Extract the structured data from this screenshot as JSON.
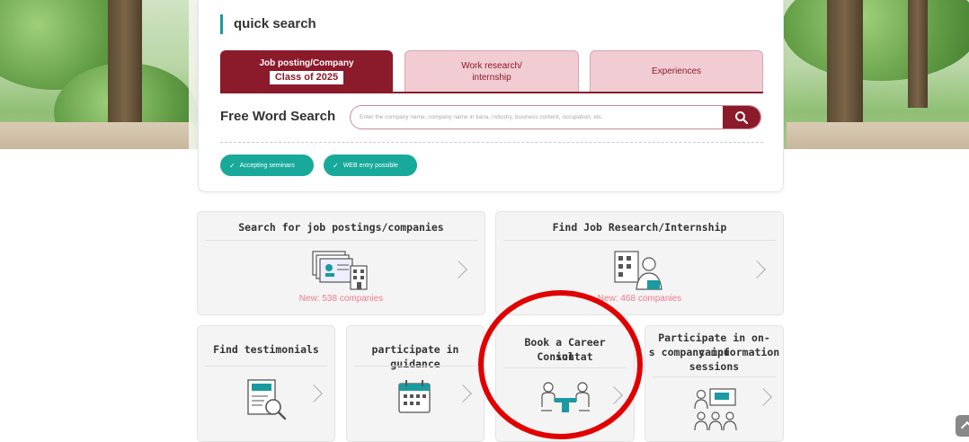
{
  "quick_search": {
    "title": "quick search",
    "tabs": [
      {
        "label": "Job posting/Company",
        "badge": "Class of 2025"
      },
      {
        "label_line1": "Work research/",
        "label_line2": "internship"
      },
      {
        "label": "Experiences"
      }
    ],
    "free_word": {
      "label": "Free Word Search",
      "placeholder": "Enter the company name, company name in kana, industry, business content, occupation, etc."
    },
    "chips": [
      "Accepting seminars",
      "WEB entry possible"
    ]
  },
  "menu": {
    "job_postings": {
      "title": "Search for job postings/companies",
      "count": "New: 538 companies"
    },
    "job_research": {
      "title": "Find Job Research/Internship",
      "count": "New: 468 companies"
    },
    "testimonials": {
      "title": "Find testimonials"
    },
    "guidance": {
      "title": "participate in guidance"
    },
    "consultation": {
      "title_line1": "Book a Career Consultat",
      "title_line2": "ion"
    },
    "info_sessions": {
      "title_line1": "Participate in on-campu",
      "title_line2": "s company information",
      "title_line3": "sessions"
    }
  },
  "colors": {
    "brand": "#8b1a2a",
    "accent": "#19a99b",
    "highlight": "#e00000",
    "new_count": "#f07b8b"
  },
  "icons": [
    "search-icon",
    "check-icon",
    "company-listing-icon",
    "internship-icon",
    "testimonial-icon",
    "calendar-icon",
    "consultation-icon",
    "seminar-icon",
    "chevron-right-icon",
    "scroll-top-icon"
  ]
}
